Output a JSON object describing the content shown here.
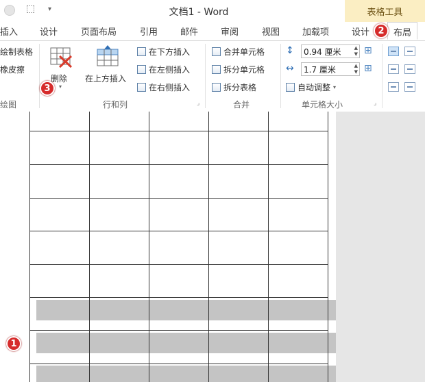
{
  "titlebar": {
    "doc_title": "文档1 - Word",
    "context_group": "表格工具"
  },
  "tabs": [
    {
      "label": "插入"
    },
    {
      "label": "设计"
    },
    {
      "label": "页面布局"
    },
    {
      "label": "引用"
    },
    {
      "label": "邮件"
    },
    {
      "label": "审阅"
    },
    {
      "label": "视图"
    },
    {
      "label": "加载项"
    },
    {
      "label": "设计"
    },
    {
      "label": "布局"
    }
  ],
  "ribbon": {
    "draw": {
      "draw_table": "绘制表格",
      "eraser": "橡皮擦",
      "label": "绘图"
    },
    "rows_cols": {
      "delete": "删除",
      "insert_above": "在上方插入",
      "insert_below": "在下方插入",
      "insert_left": "在左侧插入",
      "insert_right": "在右侧插入",
      "label": "行和列"
    },
    "merge": {
      "merge_cells": "合并单元格",
      "split_cells": "拆分单元格",
      "split_table": "拆分表格",
      "label": "合并"
    },
    "cell_size": {
      "height": "0.94 厘米",
      "width": "1.7 厘米",
      "autofit": "自动调整",
      "label": "单元格大小"
    }
  },
  "badges": {
    "one": "1",
    "two": "2",
    "three": "3"
  },
  "colors": {
    "context_tab": "#fbeec3",
    "badge": "#d62b2b",
    "selection": "#c4c4c4"
  }
}
